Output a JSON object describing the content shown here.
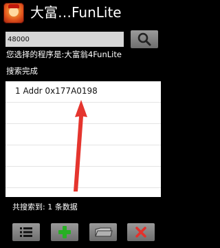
{
  "app": {
    "icon": "dafuweng-app-icon",
    "title": "大富…FunLite"
  },
  "search": {
    "value": "48000",
    "button_icon": "search-icon"
  },
  "info": {
    "selected_program": "您选择的程序是:大富翁4FunLite",
    "search_status": "搜索完成"
  },
  "results": {
    "items": [
      {
        "label": "1 Addr 0x177A0198"
      }
    ]
  },
  "status": {
    "summary": "共搜索到: 1 条数据"
  },
  "toolbar": {
    "buttons": [
      {
        "icon": "list-icon"
      },
      {
        "icon": "plus-icon",
        "color": "#27b023"
      },
      {
        "icon": "folder-icon"
      },
      {
        "icon": "close-icon",
        "color": "#e4312b"
      }
    ]
  },
  "annotation": {
    "arrow_color": "#e5352e"
  }
}
